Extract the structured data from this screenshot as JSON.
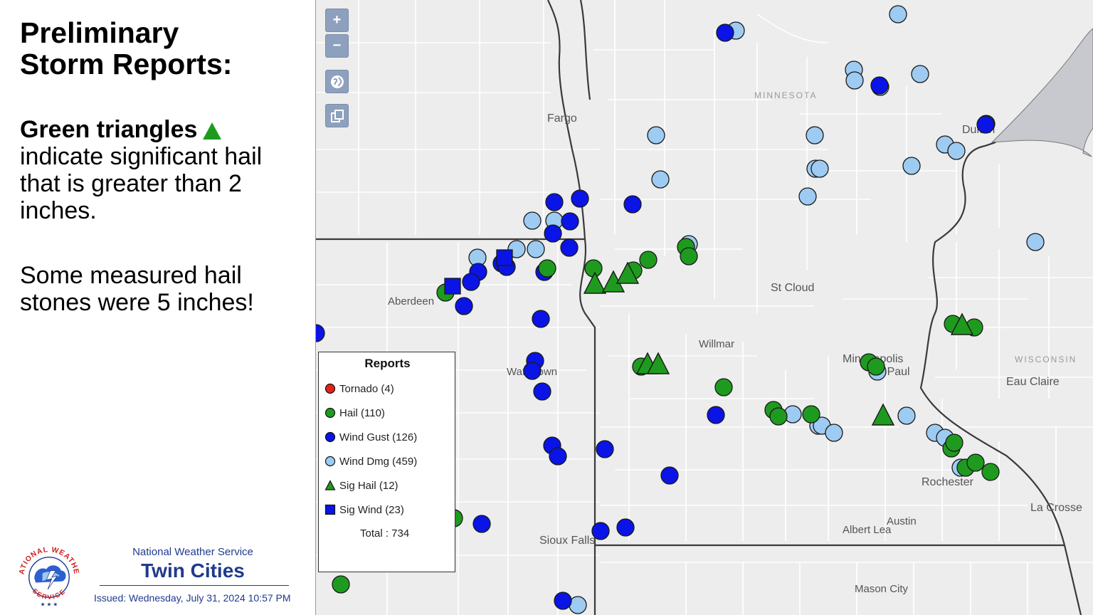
{
  "title_lines": [
    "Preliminary",
    "Storm Reports:"
  ],
  "description": {
    "bold": "Green triangles",
    "rest": "indicate significant hail that is greater than 2 inches."
  },
  "note": "Some measured hail stones were 5 inches!",
  "office": {
    "name": "National Weather Service",
    "title": "Twin Cities",
    "issued": "Issued: Wednesday, July 31, 2024 10:57 PM",
    "seal_text_top": "NATIONAL WEATHER",
    "seal_text_bottom": "SERVICE"
  },
  "map_controls": [
    {
      "name": "zoom-in-button",
      "label": "+",
      "icon": "plus-icon"
    },
    {
      "name": "zoom-out-button",
      "label": "−",
      "icon": "minus-icon"
    },
    {
      "name": "globe-button",
      "label": "",
      "icon": "globe-icon"
    },
    {
      "name": "layers-button",
      "label": "",
      "icon": "layers-icon"
    }
  ],
  "legend": {
    "title": "Reports",
    "items": [
      {
        "label": "Tornado (4)",
        "shape": "circle",
        "color": "#e8201c"
      },
      {
        "label": "Hail (110)",
        "shape": "circle",
        "color": "#1e9b1e"
      },
      {
        "label": "Wind Gust (126)",
        "shape": "circle",
        "color": "#0a14e6"
      },
      {
        "label": "Wind Dmg (459)",
        "shape": "circle",
        "color": "#9ecbf2"
      },
      {
        "label": "Sig Hail (12)",
        "shape": "triangle",
        "color": "#1e9b1e"
      },
      {
        "label": "Sig Wind (23)",
        "shape": "square",
        "color": "#0a14e6"
      }
    ],
    "total": "Total : 734"
  },
  "colors": {
    "hail": "#1e9b1e",
    "wind_gust": "#0a14e6",
    "wind_dmg": "#9ecbf2",
    "tornado": "#e8201c",
    "map_background": "#ededed",
    "lake": "#c8c9cf",
    "office_blue": "#1f3a8f"
  },
  "map_labels": [
    {
      "name": "state-label-minnesota",
      "text": "MINNESOTA",
      "style": "state"
    },
    {
      "name": "state-label-wisconsin",
      "text": "WISCONSIN",
      "style": "state"
    },
    {
      "name": "city-label-fargo",
      "text": "Fargo",
      "style": "city"
    },
    {
      "name": "city-label-duluth",
      "text": "Duluth",
      "style": "city"
    },
    {
      "name": "city-label-st-cloud",
      "text": "St Cloud",
      "style": "city"
    },
    {
      "name": "city-label-aberdeen",
      "text": "Aberdeen",
      "style": "city"
    },
    {
      "name": "city-label-willmar",
      "text": "Willmar",
      "style": "city"
    },
    {
      "name": "city-label-minneapolis",
      "text": "Minneapolis",
      "style": "city"
    },
    {
      "name": "city-label-st-paul",
      "text": "St Paul",
      "style": "city"
    },
    {
      "name": "city-label-eau-claire",
      "text": "Eau Claire",
      "style": "city"
    },
    {
      "name": "city-label-watertown",
      "text": "Watertown",
      "style": "city"
    },
    {
      "name": "city-label-rochester",
      "text": "Rochester",
      "style": "city"
    },
    {
      "name": "city-label-la-crosse",
      "text": "La Crosse",
      "style": "city"
    },
    {
      "name": "city-label-austin",
      "text": "Austin",
      "style": "city"
    },
    {
      "name": "city-label-albert-lea",
      "text": "Albert Lea",
      "style": "city"
    },
    {
      "name": "city-label-sioux-falls",
      "text": "Sioux Falls",
      "style": "city"
    },
    {
      "name": "city-label-mason-city",
      "text": "Mason City",
      "style": "city"
    }
  ]
}
